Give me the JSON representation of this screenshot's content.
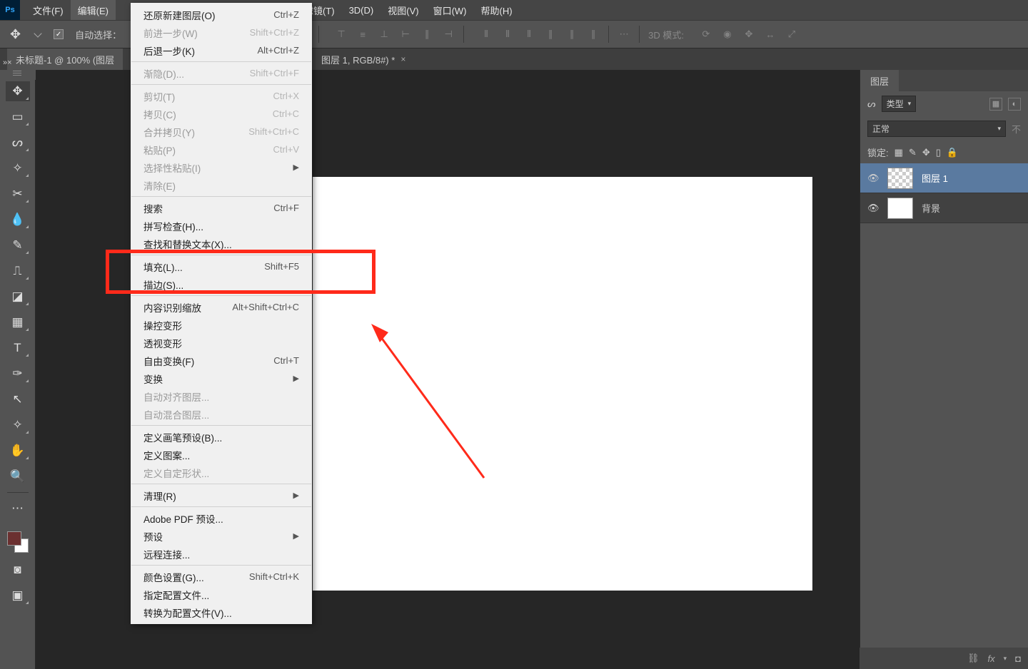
{
  "menubar": {
    "items": [
      "文件(F)",
      "编辑(E)",
      "",
      "",
      "",
      "滤镜(T)",
      "3D(D)",
      "视图(V)",
      "窗口(W)",
      "帮助(H)"
    ]
  },
  "options": {
    "autoSelect": "自动选择：",
    "mode3d": "3D 模式:"
  },
  "tabs": {
    "active": "未标题-1 @ 100% (图层",
    "second": "图层 1, RGB/8#) *"
  },
  "editMenu": {
    "items": [
      {
        "l": "还原新建图层(O)",
        "s": "Ctrl+Z"
      },
      {
        "l": "前进一步(W)",
        "s": "Shift+Ctrl+Z",
        "d": true
      },
      {
        "l": "后退一步(K)",
        "s": "Alt+Ctrl+Z"
      },
      {
        "sep": true
      },
      {
        "l": "渐隐(D)...",
        "s": "Shift+Ctrl+F",
        "d": true
      },
      {
        "sep": true
      },
      {
        "l": "剪切(T)",
        "s": "Ctrl+X",
        "d": true
      },
      {
        "l": "拷贝(C)",
        "s": "Ctrl+C",
        "d": true
      },
      {
        "l": "合并拷贝(Y)",
        "s": "Shift+Ctrl+C",
        "d": true
      },
      {
        "l": "粘贴(P)",
        "s": "Ctrl+V",
        "d": true
      },
      {
        "l": "选择性粘贴(I)",
        "sub": true,
        "d": true
      },
      {
        "l": "清除(E)",
        "d": true
      },
      {
        "sep": true
      },
      {
        "l": "搜索",
        "s": "Ctrl+F"
      },
      {
        "l": "拼写检查(H)..."
      },
      {
        "l": "查找和替换文本(X)..."
      },
      {
        "sep": true
      },
      {
        "l": "填充(L)...",
        "s": "Shift+F5"
      },
      {
        "l": "描边(S)..."
      },
      {
        "sep": true
      },
      {
        "l": "内容识别缩放",
        "s": "Alt+Shift+Ctrl+C"
      },
      {
        "l": "操控变形"
      },
      {
        "l": "透视变形"
      },
      {
        "l": "自由变换(F)",
        "s": "Ctrl+T"
      },
      {
        "l": "变换",
        "sub": true
      },
      {
        "l": "自动对齐图层...",
        "d": true
      },
      {
        "l": "自动混合图层...",
        "d": true
      },
      {
        "sep": true
      },
      {
        "l": "定义画笔预设(B)..."
      },
      {
        "l": "定义图案..."
      },
      {
        "l": "定义自定形状...",
        "d": true
      },
      {
        "sep": true
      },
      {
        "l": "清理(R)",
        "sub": true
      },
      {
        "sep": true
      },
      {
        "l": "Adobe PDF 预设..."
      },
      {
        "l": "预设",
        "sub": true
      },
      {
        "l": "远程连接..."
      },
      {
        "sep": true
      },
      {
        "l": "颜色设置(G)...",
        "s": "Shift+Ctrl+K"
      },
      {
        "l": "指定配置文件..."
      },
      {
        "l": "转换为配置文件(V)..."
      }
    ]
  },
  "layersPanel": {
    "title": "图层",
    "filter": "类型",
    "blend": "正常",
    "lock": "锁定:",
    "truncated": "不",
    "items": [
      {
        "name": "图层 1",
        "trans": true,
        "sel": true
      },
      {
        "name": "背景"
      }
    ],
    "foot_fx": "fx"
  }
}
